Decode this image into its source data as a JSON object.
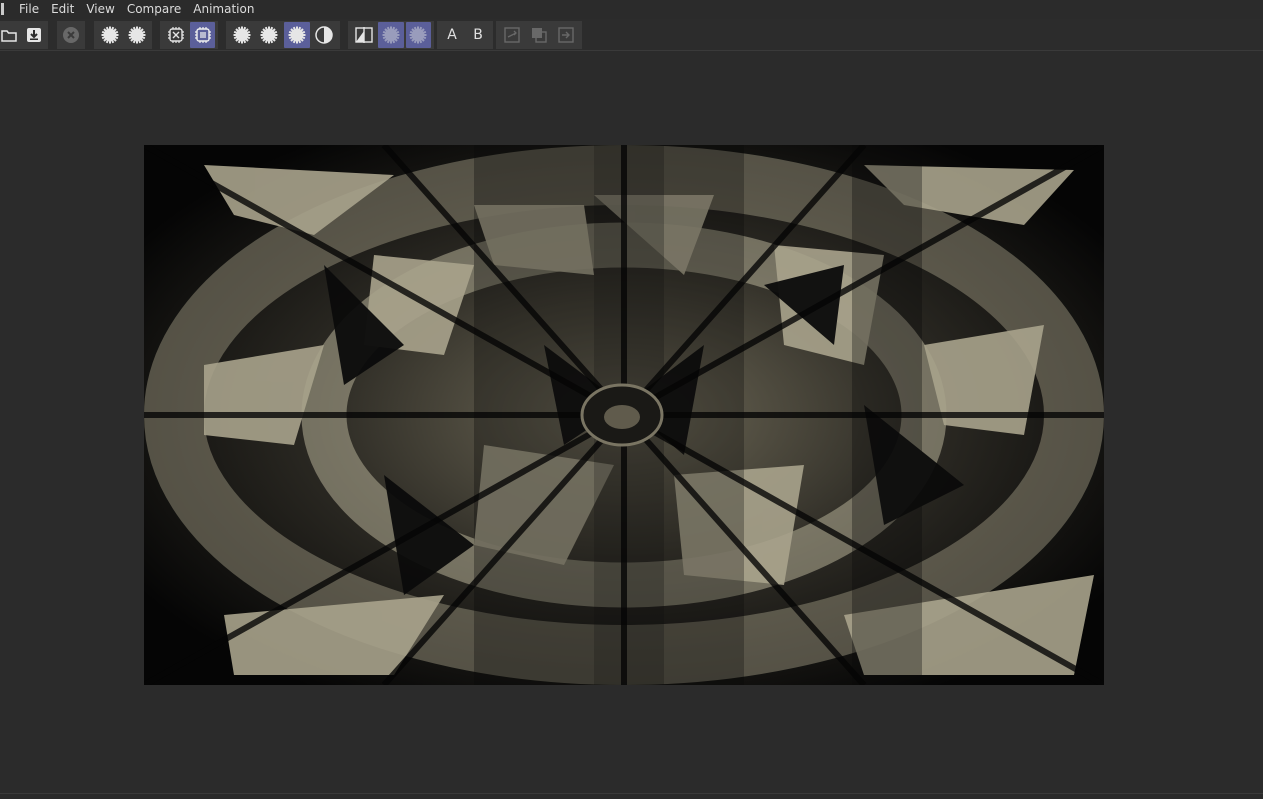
{
  "menu": {
    "items": [
      "File",
      "Edit",
      "View",
      "Compare",
      "Animation"
    ]
  },
  "toolbar": {
    "groups": [
      {
        "buttons": [
          {
            "icon": "folder-open-icon"
          },
          {
            "icon": "save-download-icon"
          }
        ]
      },
      {
        "buttons": [
          {
            "icon": "close-circle-icon",
            "disabled": true
          }
        ]
      },
      {
        "buttons": [
          {
            "icon": "gear-icon"
          },
          {
            "icon": "gear-icon"
          }
        ]
      },
      {
        "buttons": [
          {
            "icon": "chip-x-icon"
          },
          {
            "icon": "chip-list-icon",
            "active": true
          }
        ]
      },
      {
        "buttons": [
          {
            "icon": "gear-icon"
          },
          {
            "icon": "gear-icon"
          },
          {
            "icon": "gear-icon",
            "active": true
          },
          {
            "icon": "contrast-icon"
          }
        ]
      },
      {
        "buttons": [
          {
            "icon": "split-compare-icon"
          },
          {
            "icon": "gear-icon",
            "active": true
          },
          {
            "icon": "gear-icon",
            "active": true
          }
        ]
      },
      {
        "buttons": [
          {
            "label": "A"
          },
          {
            "label": "B"
          }
        ]
      },
      {
        "buttons": [
          {
            "icon": "swap-icon",
            "disabled": true
          },
          {
            "icon": "overlay-icon",
            "disabled": true
          },
          {
            "icon": "diff-icon",
            "disabled": true
          }
        ]
      }
    ]
  },
  "colors": {
    "accent": "#5b5f9a",
    "background": "#2b2b2b",
    "toolbar_group": "#3a3a3a",
    "image_light": "#a9a38c",
    "image_dark": "#050505"
  },
  "image": {
    "description_icon": "rendered-image-viewport"
  }
}
